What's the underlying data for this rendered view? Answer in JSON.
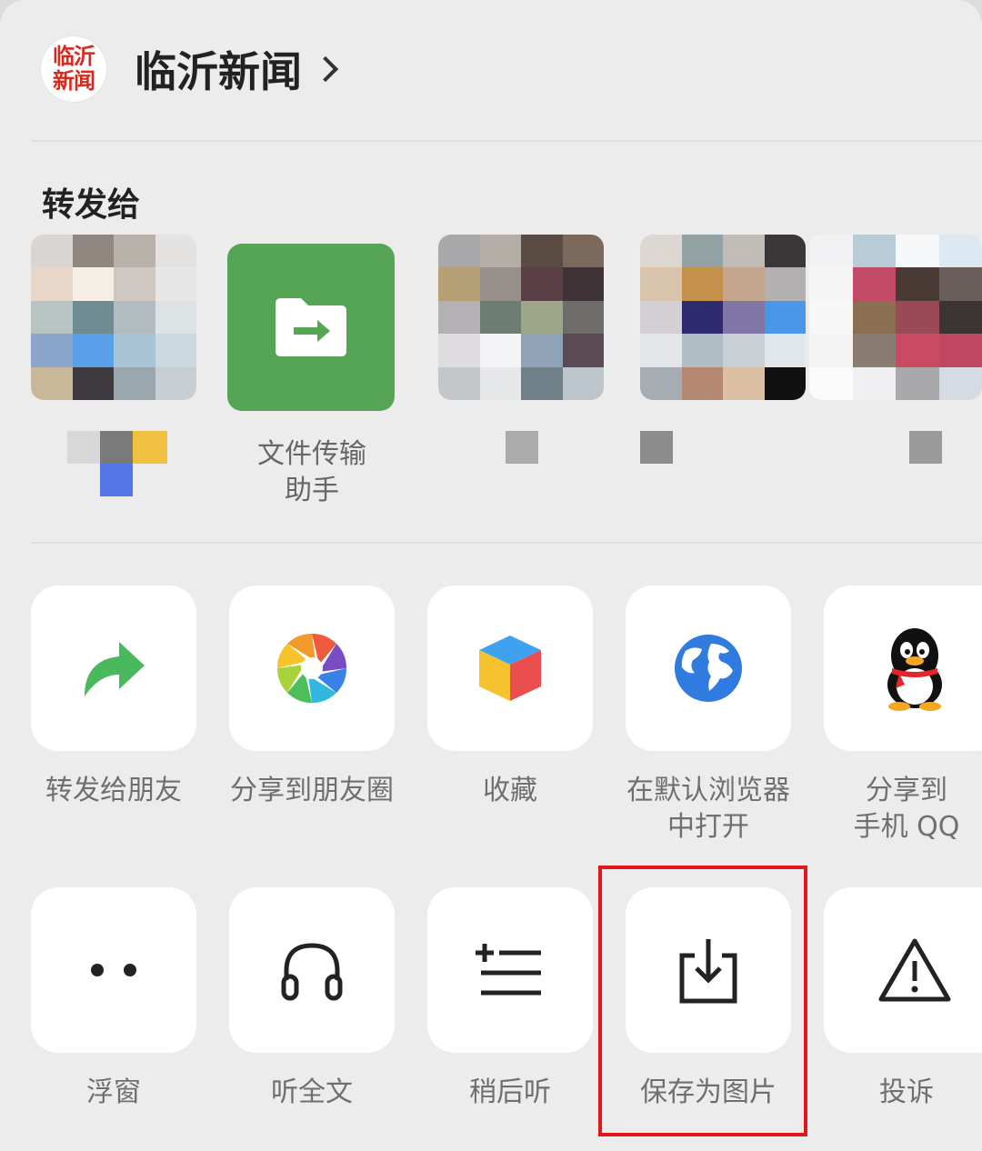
{
  "account": {
    "logo_line1": "临沂",
    "logo_line2": "新闻",
    "name": "临沂新闻"
  },
  "forward_section": {
    "title": "转发给",
    "contacts": [
      {
        "label": ""
      },
      {
        "label_line1": "文件传输",
        "label_line2": "助手"
      },
      {
        "label": ""
      },
      {
        "label": ""
      },
      {
        "label": ""
      }
    ]
  },
  "actions_row1": [
    {
      "label": "转发给朋友",
      "icon": "forward-arrow-icon",
      "color": "#4ab95e"
    },
    {
      "label": "分享到朋友圈",
      "icon": "moments-aperture-icon"
    },
    {
      "label": "收藏",
      "icon": "favorite-cube-icon"
    },
    {
      "label_line1": "在默认浏览器",
      "label_line2": "中打开",
      "icon": "globe-icon",
      "color": "#2f7be0"
    },
    {
      "label_line1": "分享到",
      "label_line2": "手机 QQ",
      "icon": "qq-penguin-icon"
    }
  ],
  "actions_row2": [
    {
      "label": "浮窗",
      "icon": "floating-window-icon"
    },
    {
      "label": "听全文",
      "icon": "headphones-icon"
    },
    {
      "label": "稍后听",
      "icon": "listen-later-icon"
    },
    {
      "label": "保存为图片",
      "icon": "save-image-icon"
    },
    {
      "label": "投诉",
      "icon": "warning-icon"
    }
  ],
  "colors": {
    "sheet_bg": "#ececec",
    "tile_bg": "#ffffff",
    "highlight": "#e3161b",
    "file_transfer_green": "#55a555"
  }
}
